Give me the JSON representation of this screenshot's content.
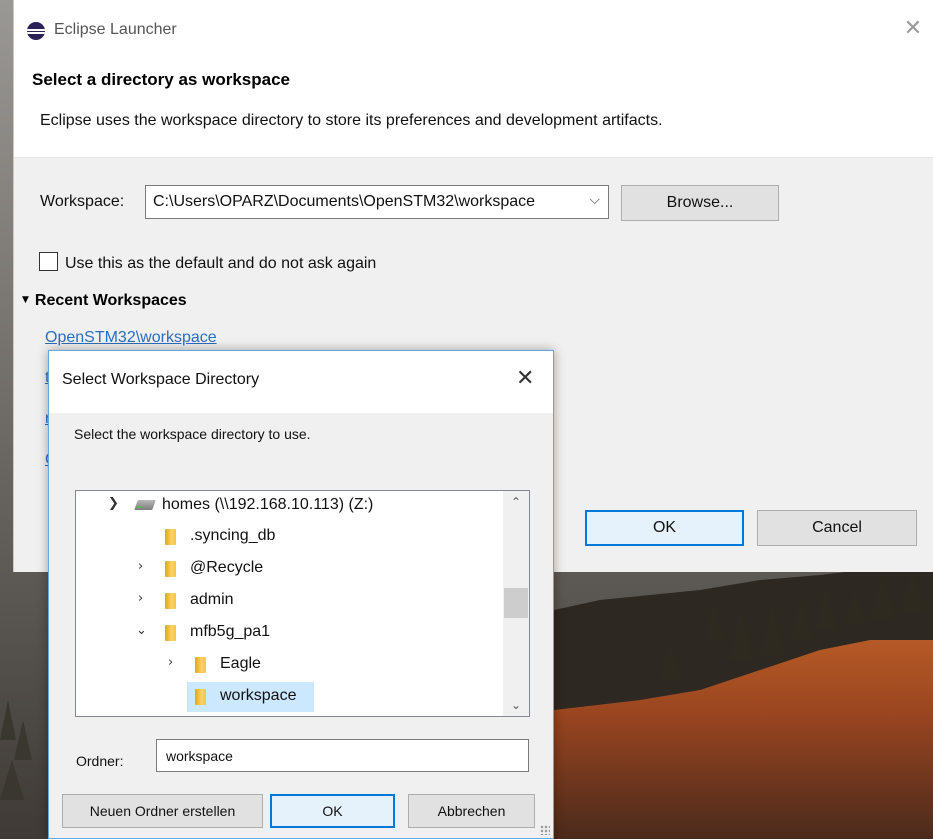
{
  "launcher": {
    "title": "Eclipse Launcher",
    "heading": "Select a directory as workspace",
    "description": "Eclipse uses the workspace directory to store its preferences and development artifacts.",
    "workspace_label": "Workspace:",
    "workspace_value": "C:\\Users\\OPARZ\\Documents\\OpenSTM32\\workspace",
    "browse_label": "Browse...",
    "default_checkbox_label": "Use this as the default and do not ask again",
    "default_checked": false,
    "recent_header": "Recent Workspaces",
    "recent_items": [
      "OpenSTM32\\workspace"
    ],
    "ok_label": "OK",
    "cancel_label": "Cancel"
  },
  "dialog": {
    "title": "Select Workspace Directory",
    "description": "Select the workspace directory to use.",
    "tree": [
      {
        "label": "homes (\\\\192.168.10.113) (Z:)",
        "expanded": true,
        "icon": "network-drive-icon"
      },
      {
        "label": ".syncing_db",
        "expanded": null,
        "icon": "folder-icon"
      },
      {
        "label": "@Recycle",
        "expanded": false,
        "icon": "folder-icon"
      },
      {
        "label": "admin",
        "expanded": false,
        "icon": "folder-icon"
      },
      {
        "label": "mfb5g_pa1",
        "expanded": true,
        "icon": "folder-icon"
      },
      {
        "label": "Eagle",
        "expanded": false,
        "icon": "folder-icon"
      },
      {
        "label": "workspace",
        "expanded": null,
        "icon": "folder-icon",
        "selected": true
      }
    ],
    "folder_label": "Ordner:",
    "folder_value": "workspace",
    "new_folder_label": "Neuen Ordner erstellen",
    "ok_label": "OK",
    "cancel_label": "Abbrechen"
  },
  "colors": {
    "accent": "#0078d7",
    "link": "#2a6ebf",
    "selection": "#cce8ff",
    "folder": "#f5c542"
  }
}
